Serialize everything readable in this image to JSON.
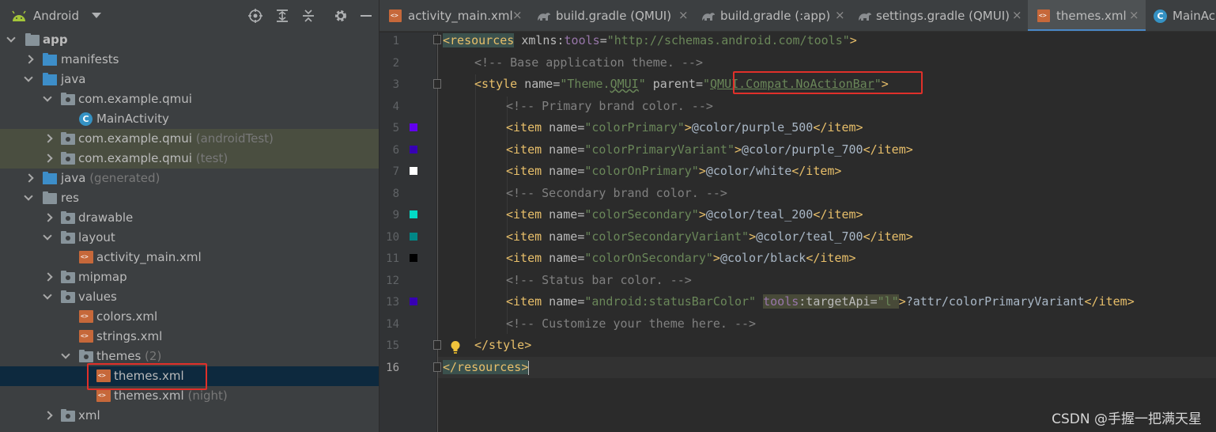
{
  "project_panel": {
    "title": "Android",
    "tools": [
      "crosshair-icon",
      "expand-all-icon",
      "collapse-all-icon",
      "gear-icon",
      "minimize-icon"
    ],
    "tree": [
      {
        "label": "app",
        "sub": "",
        "icon": "module-folder-icon"
      },
      {
        "label": "manifests",
        "sub": "",
        "icon": "folder-icon"
      },
      {
        "label": "java",
        "sub": "",
        "icon": "folder-icon"
      },
      {
        "label": "com.example.qmui",
        "sub": "",
        "icon": "package-icon"
      },
      {
        "label": "MainActivity",
        "sub": "",
        "icon": "class-icon"
      },
      {
        "label": "com.example.qmui",
        "sub": " (androidTest)",
        "icon": "package-icon"
      },
      {
        "label": "com.example.qmui",
        "sub": " (test)",
        "icon": "package-icon"
      },
      {
        "label": "java",
        "sub": " (generated)",
        "icon": "generated-folder-icon"
      },
      {
        "label": "res",
        "sub": "",
        "icon": "res-folder-icon"
      },
      {
        "label": "drawable",
        "sub": "",
        "icon": "folder-icon"
      },
      {
        "label": "layout",
        "sub": "",
        "icon": "folder-icon"
      },
      {
        "label": "activity_main.xml",
        "sub": "",
        "icon": "xml-file-icon"
      },
      {
        "label": "mipmap",
        "sub": "",
        "icon": "folder-icon"
      },
      {
        "label": "values",
        "sub": "",
        "icon": "folder-icon"
      },
      {
        "label": "colors.xml",
        "sub": "",
        "icon": "xml-file-icon"
      },
      {
        "label": "strings.xml",
        "sub": "",
        "icon": "xml-file-icon"
      },
      {
        "label": "themes",
        "sub": " (2)",
        "icon": "folder-icon"
      },
      {
        "label": "themes.xml",
        "sub": "",
        "icon": "xml-file-icon"
      },
      {
        "label": "themes.xml",
        "sub": " (night)",
        "icon": "xml-file-icon"
      },
      {
        "label": "xml",
        "sub": "",
        "icon": "folder-icon"
      }
    ]
  },
  "tabs": [
    {
      "label": "activity_main.xml",
      "icon": "xml-file-icon",
      "active": false
    },
    {
      "label": "build.gradle (QMUI)",
      "icon": "gradle-icon",
      "active": false
    },
    {
      "label": "build.gradle (:app)",
      "icon": "gradle-icon",
      "active": false
    },
    {
      "label": "settings.gradle (QMUI)",
      "icon": "gradle-icon",
      "active": false
    },
    {
      "label": "themes.xml",
      "icon": "xml-file-icon",
      "active": true
    },
    {
      "label": "MainAc",
      "icon": "class-icon",
      "active": false
    }
  ],
  "close_glyph": "×",
  "class_glyph": "C",
  "editor": {
    "line_numbers": [
      "1",
      "2",
      "3",
      "4",
      "5",
      "6",
      "7",
      "8",
      "9",
      "10",
      "11",
      "12",
      "13",
      "14",
      "15",
      "16"
    ],
    "current_line": "16",
    "color_swatches": {
      "5": "#6200EE",
      "6": "#3700B3",
      "7": "#FFFFFF",
      "9": "#03DAC5",
      "10": "#018786",
      "11": "#000000",
      "13": "#3700B3"
    },
    "code": {
      "l1": {
        "open": "<resources",
        "sp": " ",
        "ns_attr": "xmlns",
        "colon": ":",
        "ns_name": "tools",
        "eq": "=",
        "val": "\"http://schemas.android.com/tools\"",
        "close": ">"
      },
      "l2": {
        "comment": "<!-- Base application theme. -->"
      },
      "l3": {
        "open": "<style",
        "a1": " name",
        "eq1": "=",
        "v1a": "\"Theme.",
        "v1b": "QMUI",
        "v1c": "\"",
        "a2": " parent",
        "eq2": "=",
        "v2a": "\"",
        "v2b": "QMUI.Compat.NoActionBar",
        "v2c": "\"",
        "close": ">"
      },
      "l4": {
        "comment": "<!-- Primary brand color. -->"
      },
      "l5": {
        "name": "\"colorPrimary\"",
        "value": "@color/purple_500"
      },
      "l6": {
        "name": "\"colorPrimaryVariant\"",
        "value": "@color/purple_700"
      },
      "l7": {
        "name": "\"colorOnPrimary\"",
        "value": "@color/white"
      },
      "l8": {
        "comment": "<!-- Secondary brand color. -->"
      },
      "l9": {
        "name": "\"colorSecondary\"",
        "value": "@color/teal_200"
      },
      "l10": {
        "name": "\"colorSecondaryVariant\"",
        "value": "@color/teal_700"
      },
      "l11": {
        "name": "\"colorOnSecondary\"",
        "value": "@color/black"
      },
      "l12": {
        "comment": "<!-- Status bar color. -->"
      },
      "l13": {
        "name": "\"android:statusBarColor\"",
        "tools_ns": "tools",
        "tools_attr": ":targetApi",
        "tools_eq": "=",
        "tools_val": "\"l\"",
        "value": "?attr/colorPrimaryVariant"
      },
      "l14": {
        "comment": "<!-- Customize your theme here. -->"
      },
      "l15": {
        "close_tag": "</style>"
      },
      "l16": {
        "close_tag": "</resources>"
      }
    },
    "item_open": "<item",
    "item_name_attr": " name",
    "item_eq": "=",
    "item_gt": ">",
    "item_close": "</item>"
  },
  "watermark": "CSDN @手握一把满天星",
  "colors": {
    "accent": "#4a88c7",
    "highlight_box": "#e0302a",
    "selection": "#0d293e"
  }
}
